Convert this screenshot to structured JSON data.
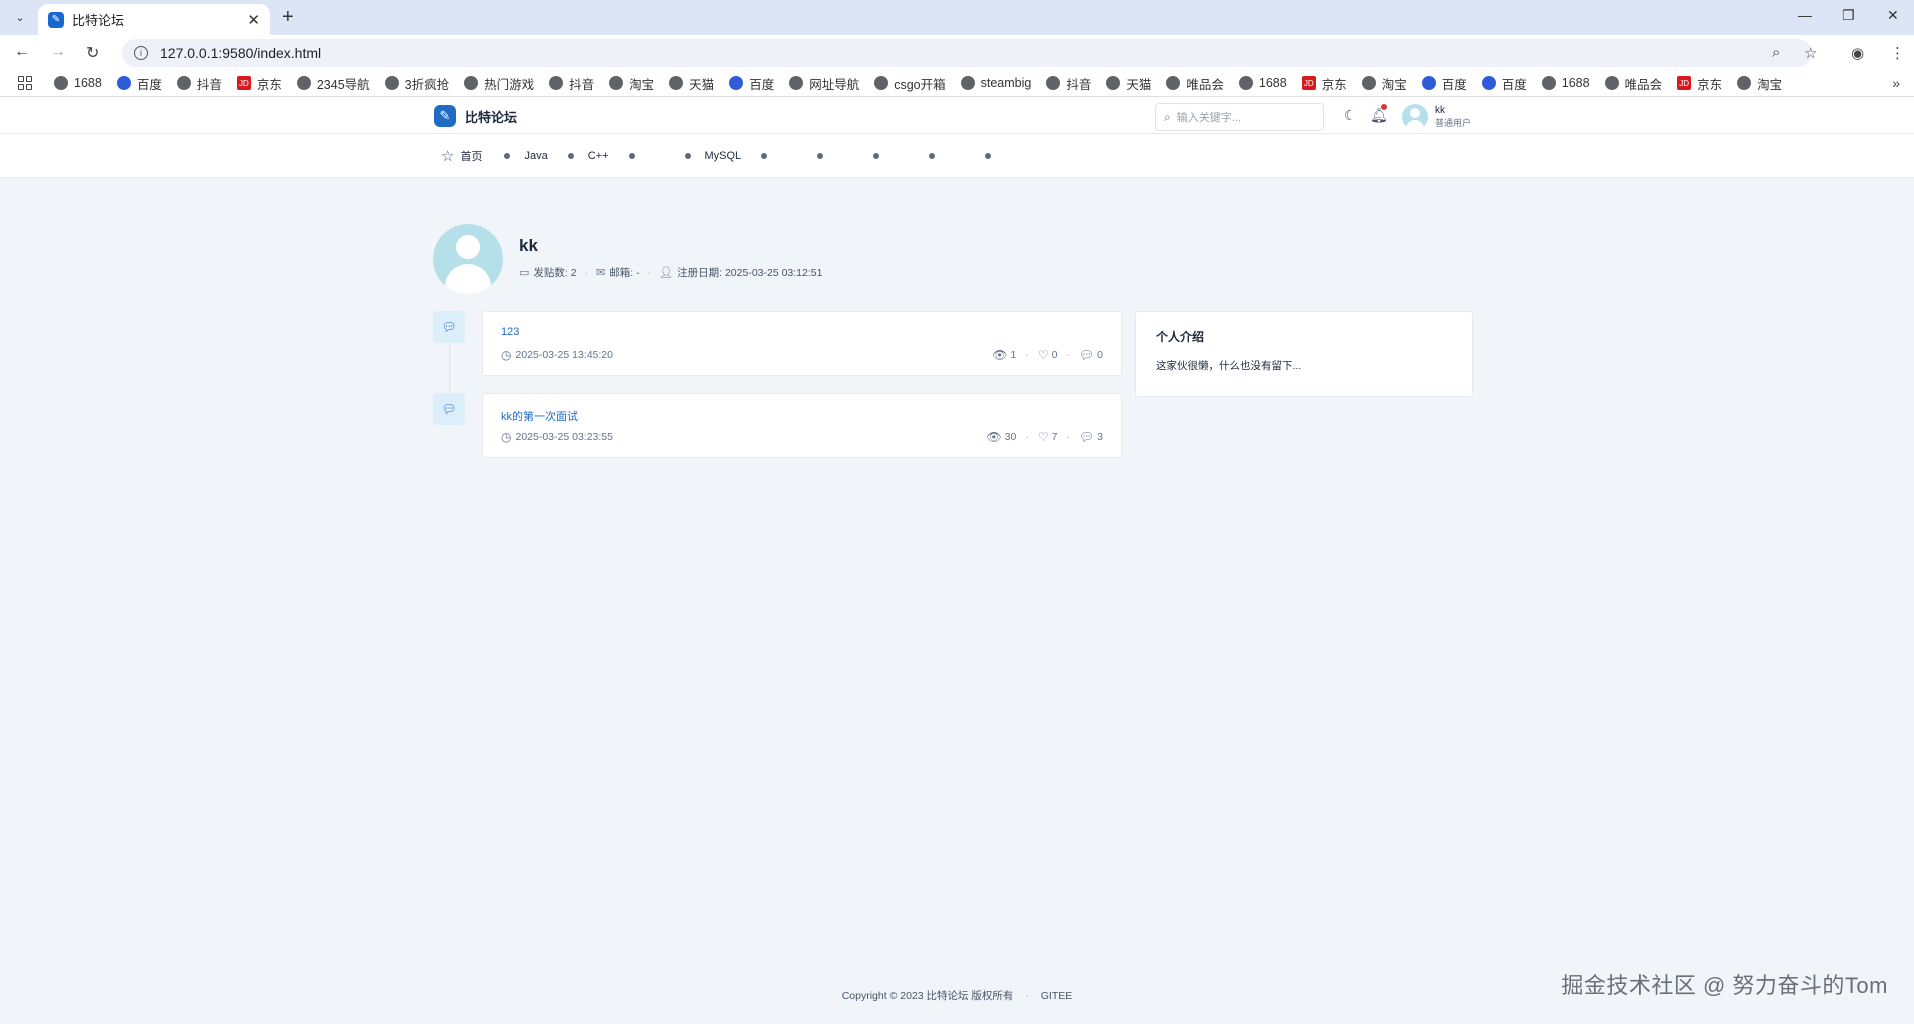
{
  "browser": {
    "tab_title": "比特论坛",
    "url": "127.0.0.1:9580/index.html",
    "bookmarks": [
      "1688",
      "百度",
      "抖音",
      "京东",
      "2345导航",
      "3折疯抢",
      "热门游戏",
      "抖音",
      "淘宝",
      "天猫",
      "百度",
      "网址导航",
      "csgo开箱",
      "steambig",
      "抖音",
      "天猫",
      "唯品会",
      "1688",
      "京东",
      "淘宝",
      "百度",
      "百度",
      "1688",
      "唯品会",
      "京东",
      "淘宝"
    ]
  },
  "header": {
    "site_name": "比特论坛",
    "search_placeholder": "输入关键字...",
    "user_name": "kk",
    "user_role": "普通用户"
  },
  "nav": {
    "home": "首页",
    "categories": [
      "Java",
      "C++",
      "",
      "MySQL",
      "",
      "",
      "",
      "",
      ""
    ]
  },
  "profile": {
    "name": "kk",
    "posts_label": "发贴数: 2",
    "email_label": "邮箱: -",
    "register_label": "注册日期: 2025-03-25 03:12:51"
  },
  "posts": [
    {
      "title": "123",
      "time": "2025-03-25 13:45:20",
      "views": "1",
      "likes": "0",
      "replies": "0"
    },
    {
      "title": "kk的第一次面试",
      "time": "2025-03-25 03:23:55",
      "views": "30",
      "likes": "7",
      "replies": "3"
    }
  ],
  "intro": {
    "title": "个人介绍",
    "text": "这家伙很懒，什么也没有留下..."
  },
  "footer": {
    "copyright": "Copyright © 2023 比特论坛 版权所有",
    "link": "GITEE"
  },
  "watermark": "掘金技术社区 @ 努力奋斗的Tom",
  "colors": {
    "accent": "#206bc4",
    "page_bg": "#f1f4f8",
    "avatar": "#b6e0e9"
  }
}
